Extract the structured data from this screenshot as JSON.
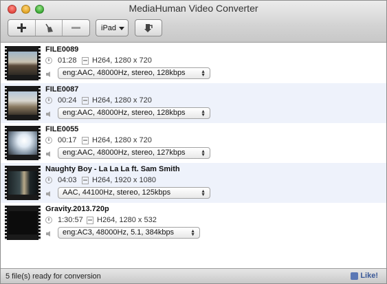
{
  "window": {
    "title": "MediaHuman Video Converter"
  },
  "toolbar": {
    "add_icon": "plus-icon",
    "clear_icon": "broom-icon",
    "remove_icon": "minus-icon",
    "preset_label": "iPad",
    "convert_icon": "convert-icon"
  },
  "files": [
    {
      "name": "FILE0089",
      "duration": "01:28",
      "video": "H264, 1280 x 720",
      "audio": "eng:AAC, 48000Hz, stereo, 128kbps"
    },
    {
      "name": "FILE0087",
      "duration": "00:24",
      "video": "H264, 1280 x 720",
      "audio": "eng:AAC, 48000Hz, stereo, 128kbps"
    },
    {
      "name": "FILE0055",
      "duration": "00:17",
      "video": "H264, 1280 x 720",
      "audio": "eng:AAC, 48000Hz, stereo, 127kbps"
    },
    {
      "name": "Naughty Boy - La La La ft. Sam Smith",
      "duration": "04:03",
      "video": "H264, 1920 x 1080",
      "audio": "AAC, 44100Hz, stereo, 125kbps"
    },
    {
      "name": "Gravity.2013.720p",
      "duration": "1:30:57",
      "video": "H264, 1280 x 532",
      "audio": "eng:AC3, 48000Hz, 5.1, 384kbps"
    }
  ],
  "status": {
    "text": "5 file(s) ready for conversion",
    "like_label": "Like!"
  }
}
